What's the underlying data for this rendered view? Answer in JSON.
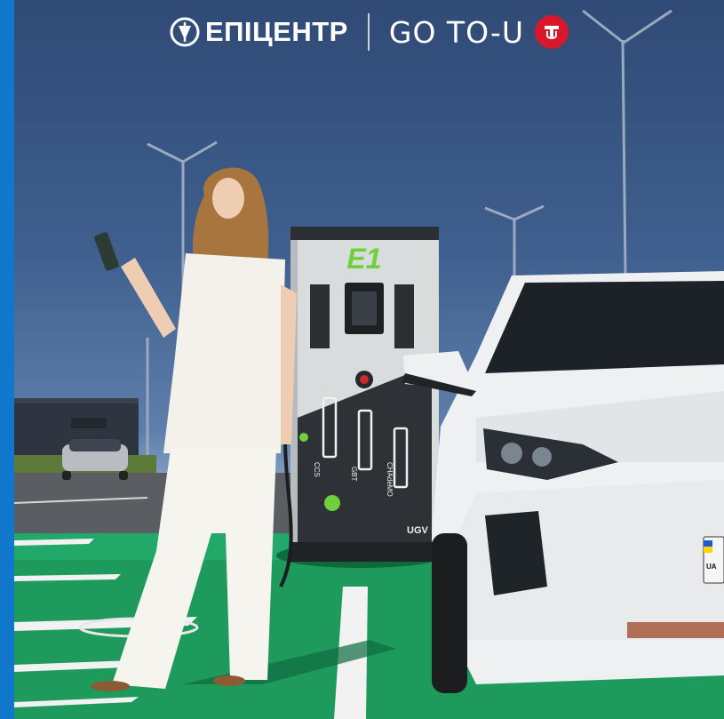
{
  "header": {
    "brand_a": "ЕПІЦЕНТР",
    "brand_b": "GO TO-U"
  },
  "charger": {
    "logo": "E1",
    "connector_1": "CCS",
    "connector_2": "GBT",
    "connector_3": "CHAdeMO",
    "maker": "UGV"
  },
  "car": {
    "plate_country": "UA"
  },
  "colors": {
    "frame": "#1a73c9",
    "sky": "#3f5f8e",
    "parking": "#1e9a5c",
    "badge": "#d8192c",
    "charger_accent": "#6fcf3c"
  }
}
